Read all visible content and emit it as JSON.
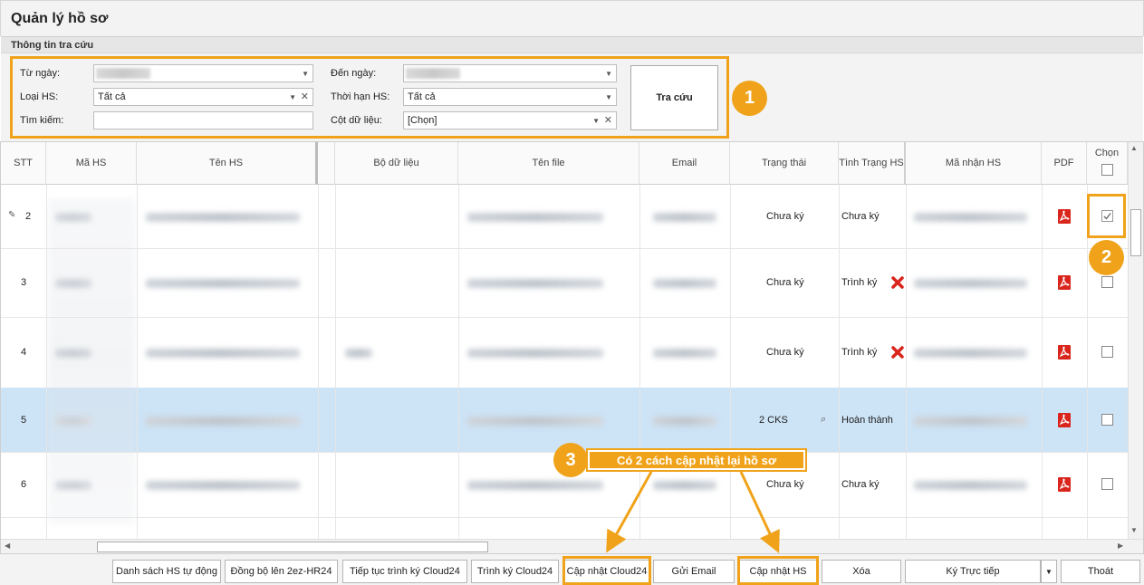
{
  "window": {
    "title": "Quản lý hồ sơ"
  },
  "search_panel": {
    "header": "Thông tin tra cứu",
    "from_date_label": "Từ ngày:",
    "to_date_label": "Đến ngày:",
    "type_label": "Loại HS:",
    "type_value": "Tất cả",
    "deadline_label": "Thời hạn HS:",
    "deadline_value": "Tất cả",
    "search_label": "Tìm kiếm:",
    "search_value": "",
    "column_label": "Cột dữ liệu:",
    "column_value": "[Chọn]",
    "search_button": "Tra cứu"
  },
  "grid": {
    "columns": [
      "STT",
      "Mã HS",
      "Tên HS",
      "Bộ dữ liệu",
      "Tên file",
      "Email",
      "Trạng thái",
      "Tình Trạng HS",
      "Mã nhận HS",
      "PDF",
      "Chọn"
    ],
    "rows": [
      {
        "stt": "2",
        "trang_thai": "Chưa ký",
        "tinh_trang": "Chưa ký",
        "checked": true,
        "error": false,
        "selected": false
      },
      {
        "stt": "3",
        "trang_thai": "Chưa ký",
        "tinh_trang": "Trình ký",
        "checked": false,
        "error": true,
        "selected": false
      },
      {
        "stt": "4",
        "trang_thai": "Chưa ký",
        "tinh_trang": "Trình ký",
        "checked": false,
        "error": true,
        "selected": false
      },
      {
        "stt": "5",
        "trang_thai": "2 CKS",
        "tinh_trang": "Hoàn thành",
        "checked": false,
        "error": false,
        "selected": true
      },
      {
        "stt": "6",
        "trang_thai": "Chưa ký",
        "tinh_trang": "Chưa ký",
        "checked": false,
        "error": false,
        "selected": false
      }
    ]
  },
  "annotations": {
    "badge1": "1",
    "badge2": "2",
    "badge3": "3",
    "callout": "Có 2 cách cập nhật lại hồ sơ"
  },
  "toolbar": {
    "danh_sach": "Danh sách HS tự động",
    "dong_bo": "Đồng bộ lên 2ez-HR24",
    "tiep_tuc": "Tiếp tục trình ký Cloud24",
    "trinh_ky": "Trình ký Cloud24",
    "cap_nhat_cloud": "Cập nhật Cloud24",
    "gui_email": "Gửi Email",
    "cap_nhat_hs": "Cập nhật HS",
    "xoa": "Xóa",
    "ky_truc_tiep": "Ký Trực tiếp",
    "thoat": "Thoát"
  },
  "colors": {
    "accent": "#f0a31a",
    "selected_row": "#cde3f6",
    "pdf": "#d9251c"
  }
}
